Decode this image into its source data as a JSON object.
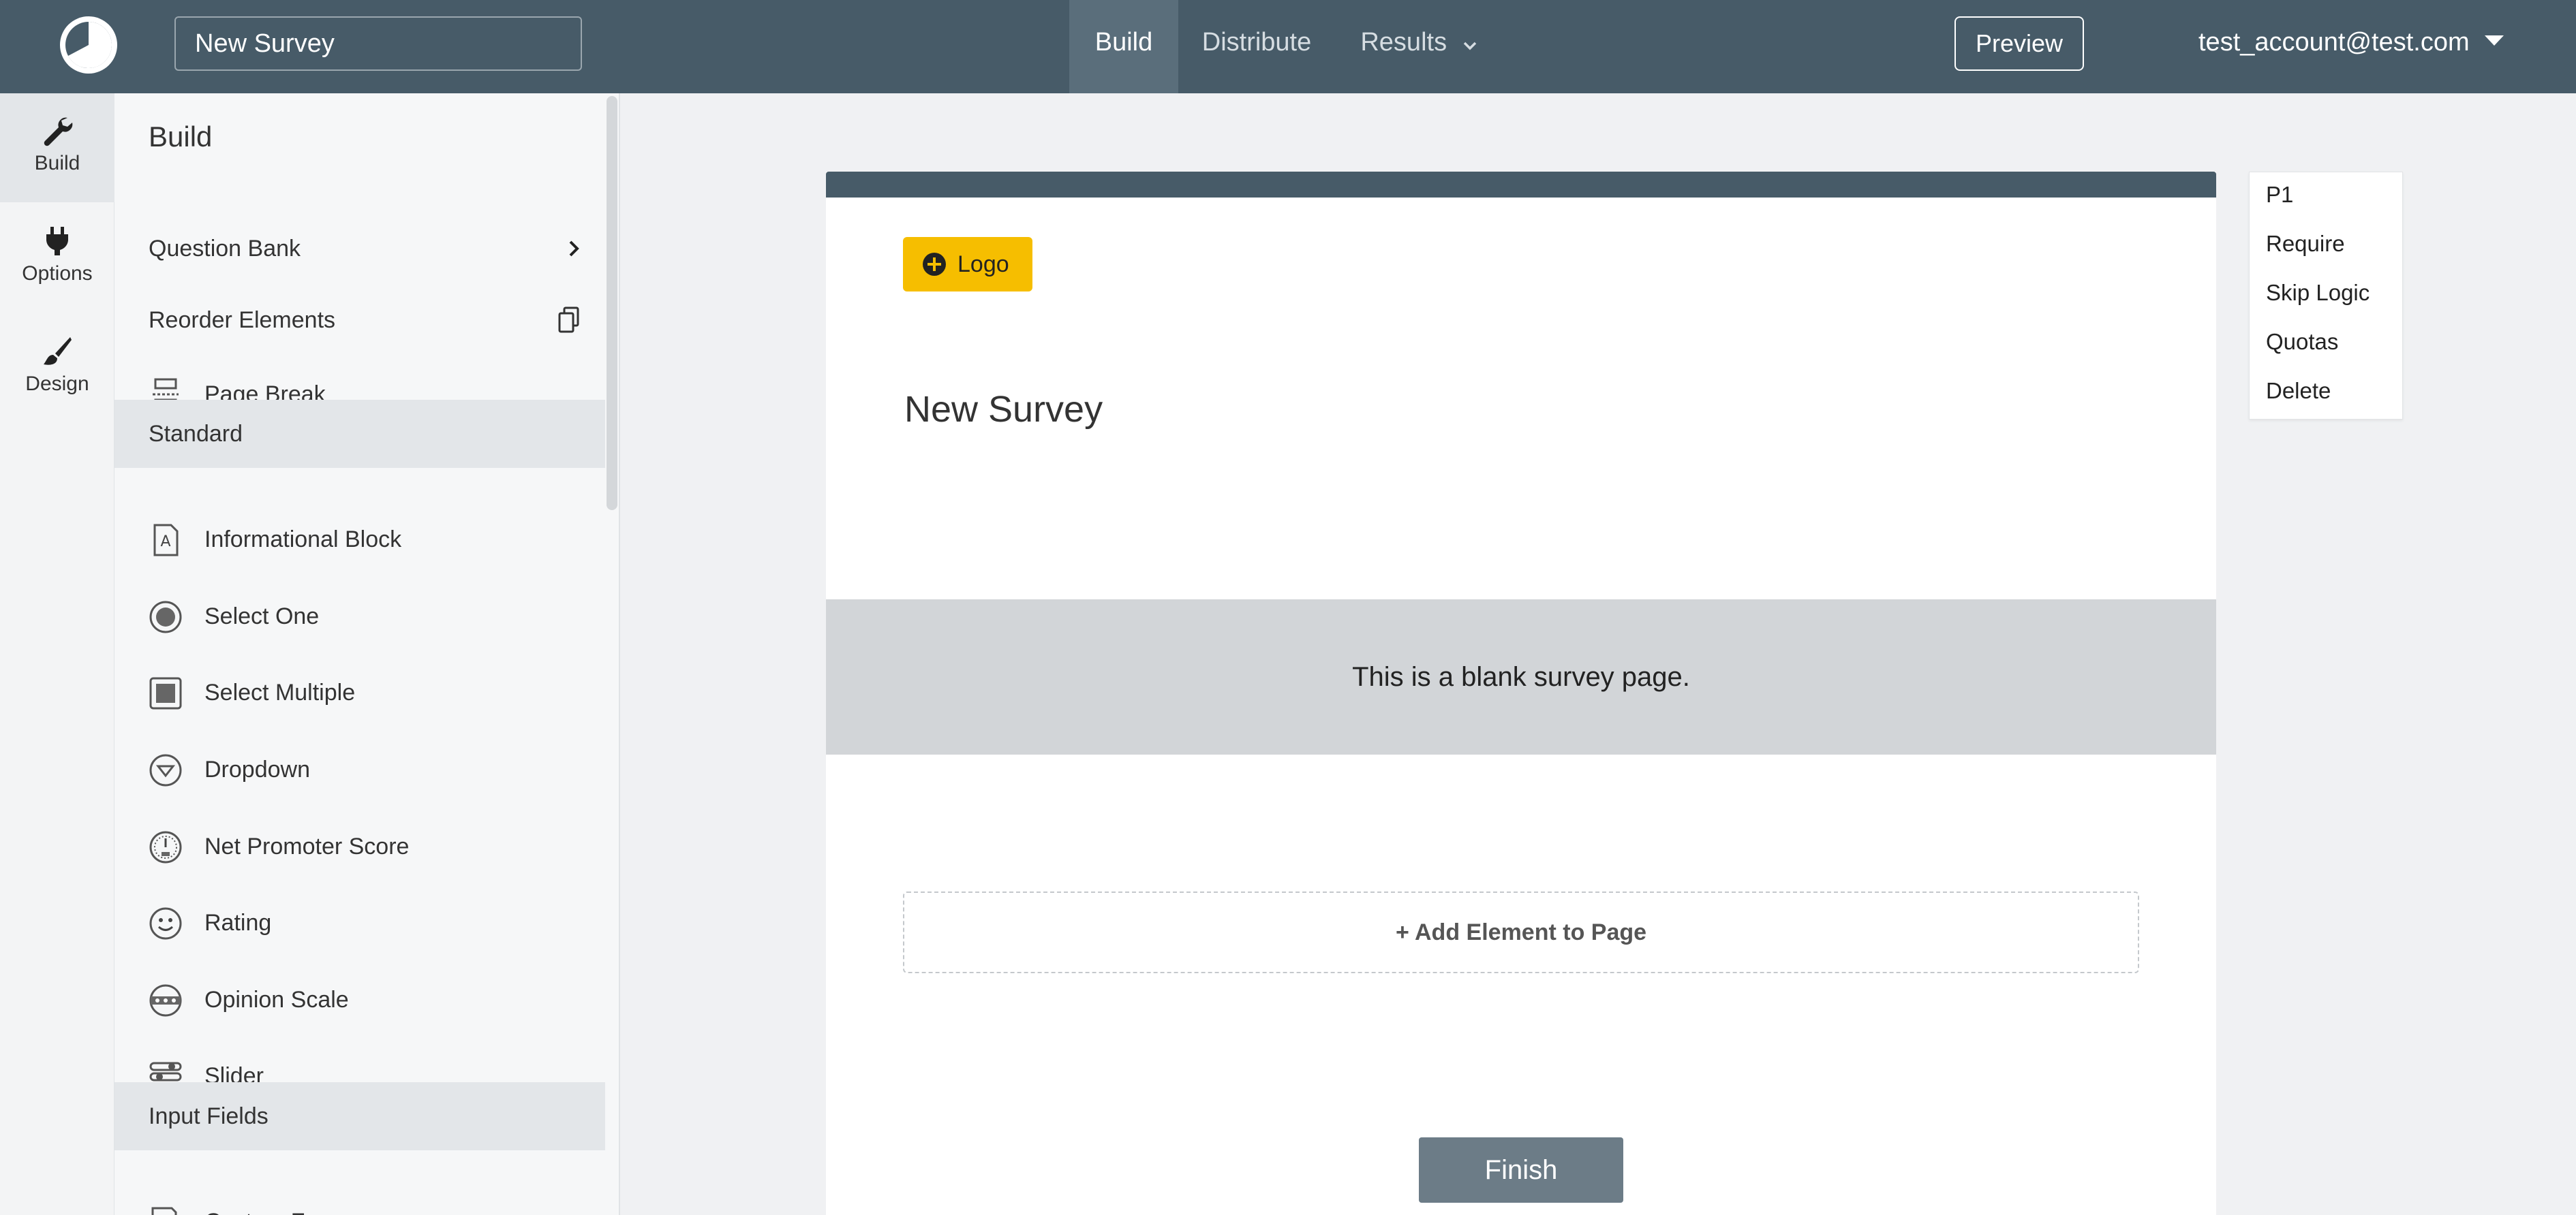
{
  "header": {
    "survey_title": "New Survey",
    "nav": {
      "build": "Build",
      "distribute": "Distribute",
      "results": "Results"
    },
    "preview_label": "Preview",
    "account": "test_account@test.com"
  },
  "rail": {
    "build": "Build",
    "options": "Options",
    "design": "Design"
  },
  "panel": {
    "heading": "Build",
    "question_bank": "Question Bank",
    "reorder": "Reorder Elements",
    "page_break": "Page Break",
    "section_standard": "Standard",
    "standard_items": [
      "Informational Block",
      "Select One",
      "Select Multiple",
      "Dropdown",
      "Net Promoter Score",
      "Rating",
      "Opinion Scale",
      "Slider"
    ],
    "section_input": "Input Fields",
    "input_items": [
      "Custom Form"
    ]
  },
  "canvas": {
    "logo_label": "Logo",
    "survey_title": "New Survey",
    "blank_message": "This is a blank survey page.",
    "add_element": "+ Add Element to Page",
    "finish_label": "Finish"
  },
  "page_menu": {
    "items": [
      "P1",
      "Require",
      "Skip Logic",
      "Quotas",
      "Delete"
    ]
  },
  "colors": {
    "header_bg": "#475b68",
    "accent_logo": "#f6be00",
    "finish_button": "#6c7c87"
  }
}
